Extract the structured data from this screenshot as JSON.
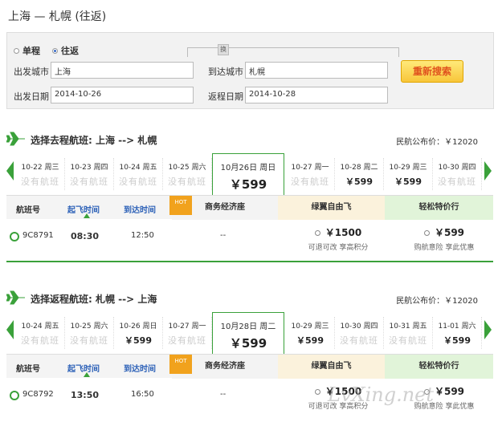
{
  "page_title": "上海 — 札幌 (往返)",
  "search": {
    "one_way_label": "单程",
    "round_trip_label": "往返",
    "swap_label": "换",
    "depart_city_label": "出发城市",
    "depart_city_value": "上海",
    "arrive_city_label": "到达城市",
    "arrive_city_value": "札幌",
    "depart_date_label": "出发日期",
    "depart_date_value": "2014-10-26",
    "return_date_label": "返程日期",
    "return_date_value": "2014-10-28",
    "search_button": "重新搜索"
  },
  "outbound": {
    "title": "选择去程航班: 上海 --> 札幌",
    "price_note": "民航公布价：￥12020",
    "days": [
      {
        "date": "10-22 周三",
        "price": "没有航班"
      },
      {
        "date": "10-23 周四",
        "price": "没有航班"
      },
      {
        "date": "10-24 周五",
        "price": "没有航班"
      },
      {
        "date": "10-25 周六",
        "price": "没有航班"
      },
      {
        "date": "10月26日 周日",
        "price": "￥599"
      },
      {
        "date": "10-27 周一",
        "price": "没有航班"
      },
      {
        "date": "10-28 周二",
        "price": "￥599"
      },
      {
        "date": "10-29 周三",
        "price": "￥599"
      },
      {
        "date": "10-30 周四",
        "price": "没有航班"
      }
    ],
    "headers": {
      "flight_no": "航班号",
      "dep_time": "起飞时间",
      "arr_time": "到达时间",
      "hot": "HOT",
      "business": "商务经济座",
      "eco": "绿翼自由飞",
      "discount": "轻松特价行"
    },
    "flight": {
      "number": "9C8791",
      "dep": "08:30",
      "arr": "12:50",
      "business": "--",
      "eco_price": "￥1500",
      "eco_note": "可退可改 享高积分",
      "discount_price": "￥599",
      "discount_note": "购航意险 享此优惠"
    }
  },
  "return": {
    "title": "选择返程航班: 札幌 --> 上海",
    "price_note": "民航公布价：￥12020",
    "days": [
      {
        "date": "10-24 周五",
        "price": "没有航班"
      },
      {
        "date": "10-25 周六",
        "price": "没有航班"
      },
      {
        "date": "10-26 周日",
        "price": "￥599"
      },
      {
        "date": "10-27 周一",
        "price": "没有航班"
      },
      {
        "date": "10月28日 周二",
        "price": "￥599"
      },
      {
        "date": "10-29 周三",
        "price": "￥599"
      },
      {
        "date": "10-30 周四",
        "price": "没有航班"
      },
      {
        "date": "10-31 周五",
        "price": "没有航班"
      },
      {
        "date": "11-01 周六",
        "price": "￥599"
      }
    ],
    "headers": {
      "flight_no": "航班号",
      "dep_time": "起飞时间",
      "arr_time": "到达时间",
      "hot": "HOT",
      "business": "商务经济座",
      "eco": "绿翼自由飞",
      "discount": "轻松特价行"
    },
    "flight": {
      "number": "9C8792",
      "dep": "13:50",
      "arr": "16:50",
      "business": "--",
      "eco_price": "￥1500",
      "eco_note": "可退可改 享高积分",
      "discount_price": "￥599",
      "discount_note": "购航意险 享此优惠"
    }
  },
  "watermark": "LvXing.net",
  "colors": {
    "accent": "#3aa13a",
    "link": "#2e62b8",
    "button": "#f8c63a"
  }
}
